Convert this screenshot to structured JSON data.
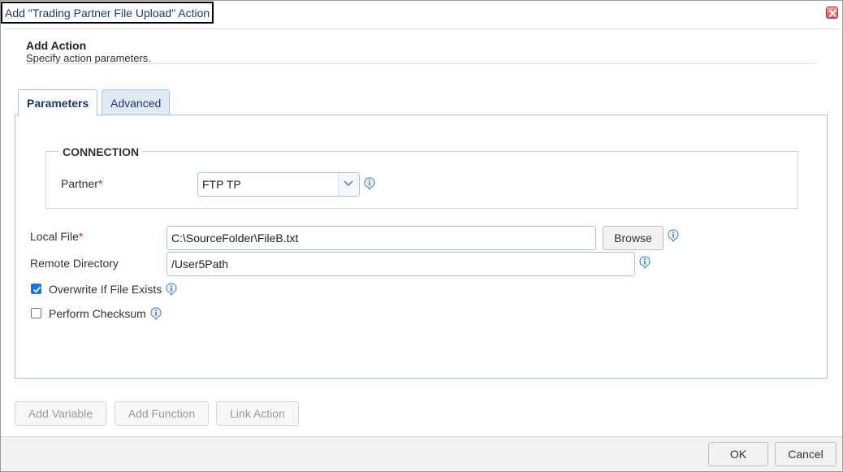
{
  "window": {
    "title": "Add \"Trading Partner File Upload\" Action",
    "close_icon": "close-icon",
    "close_color": "#e0504a"
  },
  "header": {
    "title": "Add Action",
    "subtitle": "Specify action parameters."
  },
  "tabs": [
    {
      "label": "Parameters",
      "active": true
    },
    {
      "label": "Advanced",
      "active": false
    }
  ],
  "connection": {
    "legend": "CONNECTION",
    "partner_label": "Partner",
    "required_marker": "*",
    "partner_value": "FTP TP"
  },
  "fields": {
    "local_file_label": "Local File",
    "local_file_value": "C:\\SourceFolder\\FileB.txt",
    "browse_label": "Browse",
    "remote_dir_label": "Remote Directory",
    "remote_dir_value": "/User5Path",
    "overwrite_label": "Overwrite If File Exists",
    "overwrite_checked": true,
    "checksum_label": "Perform Checksum",
    "checksum_checked": false
  },
  "action_buttons": {
    "add_variable": "Add Variable",
    "add_function": "Add Function",
    "link_action": "Link Action"
  },
  "footer": {
    "ok": "OK",
    "cancel": "Cancel"
  },
  "colors": {
    "accent": "#1d3a6e",
    "tab_border": "#a9c3dd",
    "checkbox_checked": "#1a73e8",
    "required": "#d22222"
  }
}
